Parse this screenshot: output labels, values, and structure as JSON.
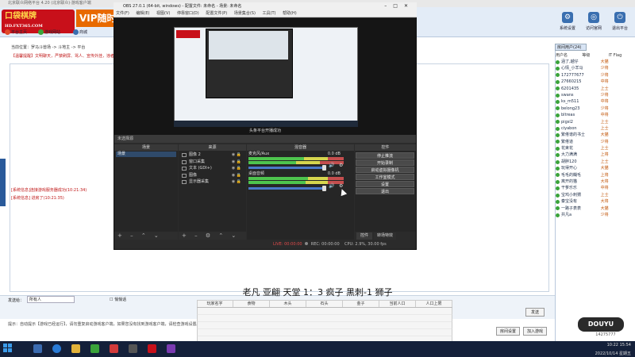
{
  "app": {
    "titlebar": "北京联众网络平台 4.20 (北京联众)·游戏客户端",
    "logo_main": "口袋棋牌",
    "logo_sub": "HD.FXT365.COM",
    "vip_banner": "VIP随时",
    "nav": [
      "平台主页",
      "游戏网站",
      "商城"
    ],
    "right_buttons": [
      {
        "label": "系统设置",
        "icon": "gear-icon"
      },
      {
        "label": "访问官网",
        "icon": "globe-icon"
      },
      {
        "label": "退出平台",
        "icon": "exit-icon"
      }
    ],
    "address": "当前位置：罗马斗兽场 -> 斗地主 -> 平台",
    "notice": "【温馨提醒】文明聊天，严禁刷屏、骂人、宣传外挂，违者封号处理。如有疑问请联系客服，祝您游戏愉快！1：请勿相信陌生人发布的中奖信息，谨防上当受骗",
    "chat_lines": [
      "[系统信息]连接游戏服务器成功(10:21:34)",
      "[系统信息] 进房了(10:21:35)"
    ],
    "send_to_label": "发送给：",
    "recipient": "所有人",
    "private_label": "悄悄话",
    "tip": "提示：自动提示【游戏已经运行】，请勿重复启动游戏客户端，如果您没有找到游戏客户端，请检查游戏设置。",
    "send_label": "发送",
    "bottom_buttons": [
      "房间设置",
      "加入游戏"
    ]
  },
  "users": {
    "tab": "房间用户(24)",
    "headers": [
      "用户名",
      "等级",
      "IT Flag"
    ],
    "rows": [
      {
        "name": "涵了,越仔",
        "rank": "大猫",
        "cc": ""
      },
      {
        "name": "心情_小羊马",
        "rank": "少将",
        "cc": ""
      },
      {
        "name": "172777677",
        "rank": "少将",
        "cc": ""
      },
      {
        "name": "27660215",
        "rank": "中将",
        "cc": ""
      },
      {
        "name": "6201435",
        "rank": "上士",
        "cc": ""
      },
      {
        "name": "swans",
        "rank": "少将",
        "cc": ""
      },
      {
        "name": "ks_m511",
        "rank": "中将",
        "cc": ""
      },
      {
        "name": "belong23",
        "rank": "少将",
        "cc": ""
      },
      {
        "name": "bltreas",
        "rank": "中将",
        "cc": ""
      },
      {
        "name": "pigsl2",
        "rank": "上士",
        "cc": ""
      },
      {
        "name": "ciyabon",
        "rank": "上士",
        "cc": ""
      },
      {
        "name": "繁倦谱的书士",
        "rank": "大猫",
        "cc": ""
      },
      {
        "name": "繁倦道",
        "rank": "少将",
        "cc": ""
      },
      {
        "name": "花束花",
        "rank": "上士",
        "cc": ""
      },
      {
        "name": "大力满满",
        "rank": "上将",
        "cc": ""
      },
      {
        "name": "胡胖120",
        "rank": "上士",
        "cc": ""
      },
      {
        "name": "玩得开心",
        "rank": "大猫",
        "cc": ""
      },
      {
        "name": "毛毛的糊毛",
        "rank": "上将",
        "cc": ""
      },
      {
        "name": "离开的猫",
        "rank": "大将",
        "cc": ""
      },
      {
        "name": "干爹乐乐",
        "rank": "中将",
        "cc": ""
      },
      {
        "name": "宝鸡小刺猬",
        "rank": "上士",
        "cc": ""
      },
      {
        "name": "秦宝没有",
        "rank": "大将",
        "cc": ""
      },
      {
        "name": "一路子表表",
        "rank": "大猫",
        "cc": ""
      },
      {
        "name": "共凡a",
        "rank": "少将",
        "cc": ""
      }
    ]
  },
  "obs": {
    "title": "OBS 27.0.1 (64-bit, windows) - 配置文件: 未命名 - 场景: 未命名",
    "menu": [
      "文件(F)",
      "编辑(E)",
      "视图(V)",
      "停靠窗口(D)",
      "配置文件(P)",
      "场景集合(S)",
      "工具(T)",
      "帮助(H)"
    ],
    "caption": "头条平台开播成功",
    "scene_bar": "未选择源",
    "docks": [
      "场景",
      "来源",
      "混音器",
      "转场特效",
      "控件"
    ],
    "scene": "场景",
    "sources": [
      "图像 2",
      "窗口采集",
      "文本 (GDI+)",
      "图像",
      "显示器采集"
    ],
    "mixer": [
      {
        "name": "麦克风/Aux",
        "db": "0.0 dB"
      },
      {
        "name": "桌面音频",
        "db": "0.0 dB"
      }
    ],
    "controls": [
      "停止推流",
      "开始录制",
      "启动虚拟摄像机",
      "工作室模式",
      "设置",
      "退出"
    ],
    "bottom_tabs": [
      "控件",
      "转场特效"
    ],
    "status": {
      "live": "LIVE: 00:00:00",
      "rec": "REC: 00:00:00",
      "cpu": "CPU: 2.9%, 30.00 fps"
    }
  },
  "overlay": {
    "title": "老凡 亚翩 天堂 1：3 疯子 黑刺-1 狮子",
    "headers": [
      "玩家名字",
      "食物",
      "木头",
      "石头",
      "金子",
      "当前人口",
      "人口上限"
    ]
  },
  "taskbar": {
    "time": "10:22 15:54",
    "date": "2022/10/14 星期五"
  },
  "watermark": {
    "brand": "DOUYU",
    "id": "14275777"
  },
  "colors": {
    "accent": "#3a6fb0",
    "notice": "#c01818",
    "obs_bg": "#2b2b2b"
  }
}
